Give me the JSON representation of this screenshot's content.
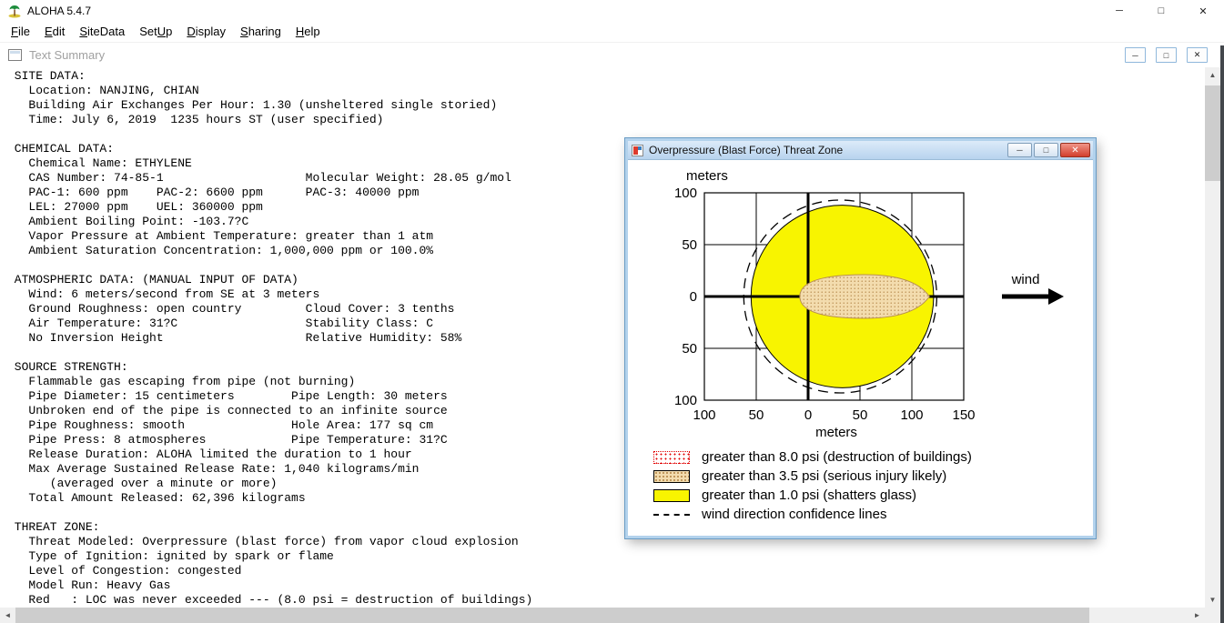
{
  "app": {
    "title": "ALOHA 5.4.7",
    "controls": {
      "minimize": "─",
      "maximize": "□",
      "close": "✕"
    }
  },
  "menu": {
    "items": [
      {
        "label": "File",
        "underline": 0
      },
      {
        "label": "Edit",
        "underline": 0
      },
      {
        "label": "SiteData",
        "underline": 0
      },
      {
        "label": "SetUp",
        "underline": 3
      },
      {
        "label": "Display",
        "underline": 0
      },
      {
        "label": "Sharing",
        "underline": 0
      },
      {
        "label": "Help",
        "underline": 0
      }
    ]
  },
  "text_summary": {
    "title": "Text Summary",
    "controls": {
      "minimize": "─",
      "maximize": "□",
      "close": "✕"
    },
    "lines": [
      " SITE DATA:",
      "   Location: NANJING, CHIAN",
      "   Building Air Exchanges Per Hour: 1.30 (unsheltered single storied)",
      "   Time: July 6, 2019  1235 hours ST (user specified)",
      "",
      " CHEMICAL DATA:",
      "   Chemical Name: ETHYLENE",
      "   CAS Number: 74-85-1                    Molecular Weight: 28.05 g/mol",
      "   PAC-1: 600 ppm    PAC-2: 6600 ppm      PAC-3: 40000 ppm",
      "   LEL: 27000 ppm    UEL: 360000 ppm",
      "   Ambient Boiling Point: -103.7?C",
      "   Vapor Pressure at Ambient Temperature: greater than 1 atm",
      "   Ambient Saturation Concentration: 1,000,000 ppm or 100.0%",
      "",
      " ATMOSPHERIC DATA: (MANUAL INPUT OF DATA)",
      "   Wind: 6 meters/second from SE at 3 meters",
      "   Ground Roughness: open country         Cloud Cover: 3 tenths",
      "   Air Temperature: 31?C                  Stability Class: C",
      "   No Inversion Height                    Relative Humidity: 58%",
      "",
      " SOURCE STRENGTH:",
      "   Flammable gas escaping from pipe (not burning)",
      "   Pipe Diameter: 15 centimeters        Pipe Length: 30 meters",
      "   Unbroken end of the pipe is connected to an infinite source",
      "   Pipe Roughness: smooth               Hole Area: 177 sq cm",
      "   Pipe Press: 8 atmospheres            Pipe Temperature: 31?C",
      "   Release Duration: ALOHA limited the duration to 1 hour",
      "   Max Average Sustained Release Rate: 1,040 kilograms/min",
      "      (averaged over a minute or more)",
      "   Total Amount Released: 62,396 kilograms",
      "",
      " THREAT ZONE:",
      "   Threat Modeled: Overpressure (blast force) from vapor cloud explosion",
      "   Type of Ignition: ignited by spark or flame",
      "   Level of Congestion: congested",
      "   Model Run: Heavy Gas",
      "   Red   : LOC was never exceeded --- (8.0 psi = destruction of buildings)"
    ]
  },
  "threat_window": {
    "title": "Overpressure (Blast Force) Threat Zone",
    "controls": {
      "minimize": "─",
      "maximize": "□",
      "close": "✕"
    },
    "plot": {
      "axis_label_top": "meters",
      "axis_label_bottom": "meters",
      "x_ticks": [
        "100",
        "50",
        "0",
        "50",
        "100",
        "150"
      ],
      "y_ticks": [
        "100",
        "50",
        "0",
        "50",
        "100"
      ],
      "wind_label": "wind"
    },
    "legend": [
      {
        "swatch": "red-dotted",
        "label": "greater than 8.0 psi (destruction of buildings)"
      },
      {
        "swatch": "tan",
        "label": "greater than 3.5 psi (serious injury likely)"
      },
      {
        "swatch": "yellow",
        "label": "greater than 1.0 psi (shatters glass)"
      },
      {
        "swatch": "dashed-line",
        "label": "wind direction confidence lines"
      }
    ]
  },
  "chart_data": {
    "type": "area",
    "title": "Overpressure (Blast Force) Threat Zone",
    "xlabel": "meters",
    "ylabel": "meters",
    "xlim": [
      -100,
      150
    ],
    "ylim": [
      -100,
      100
    ],
    "x_tick_labels": [
      "100",
      "50",
      "0",
      "50",
      "100",
      "150"
    ],
    "y_tick_labels": [
      "100",
      "50",
      "0",
      "50",
      "100"
    ],
    "grid": true,
    "wind_direction": "toward +x (right)",
    "zones": [
      {
        "loc": "greater than 1.0 psi (shatters glass)",
        "shape": "circle",
        "center_m": [
          33,
          0
        ],
        "radius_m": 88,
        "color": "#f8f400"
      },
      {
        "loc": "greater than 3.5 psi (serious injury likely)",
        "shape": "downwind-lobe",
        "x_range_m": [
          -8,
          117
        ],
        "half_width_m": 21,
        "color": "#f3dcae"
      },
      {
        "loc": "greater than 8.0 psi (destruction of buildings)",
        "shape": "not-visible-on-plot",
        "color": "#ff0000"
      },
      {
        "loc": "wind direction confidence lines",
        "shape": "dashed-circle",
        "center_m": [
          31,
          0
        ],
        "radius_m": 93,
        "color": "#000000"
      }
    ]
  }
}
